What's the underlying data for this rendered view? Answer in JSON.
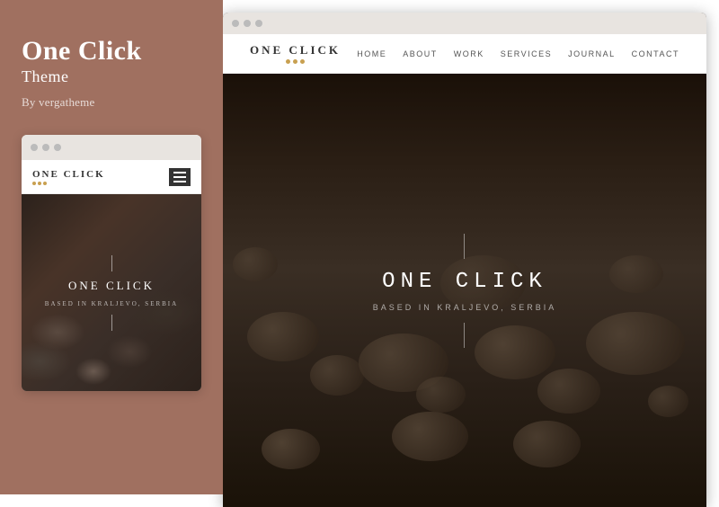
{
  "sidebar": {
    "title": "One Click",
    "subtitle": "Theme",
    "author": "By vergatheme",
    "bg_color": "#a07060"
  },
  "mobile_preview": {
    "logo_text": "ONE CLICK",
    "logo_dots": [
      "#c8a050",
      "#c8a050",
      "#c8a050"
    ],
    "hero_title": "ONE CLICK",
    "hero_subtitle": "BASED IN KRALJEVO, SERBIA"
  },
  "desktop_preview": {
    "logo_text": "ONE CLICK",
    "logo_dots": [
      "#c8a050",
      "#c8a050",
      "#c8a050"
    ],
    "nav_links": [
      "HOME",
      "ABOUT",
      "WORK",
      "SERVICES",
      "JOURNAL",
      "CONTACT"
    ],
    "hero_title": "ONE CLICK",
    "hero_subtitle": "BASED IN KRALJEVO, SERBIA"
  },
  "window_dots": {
    "d1": "#bbb",
    "d2": "#bbb",
    "d3": "#bbb"
  }
}
